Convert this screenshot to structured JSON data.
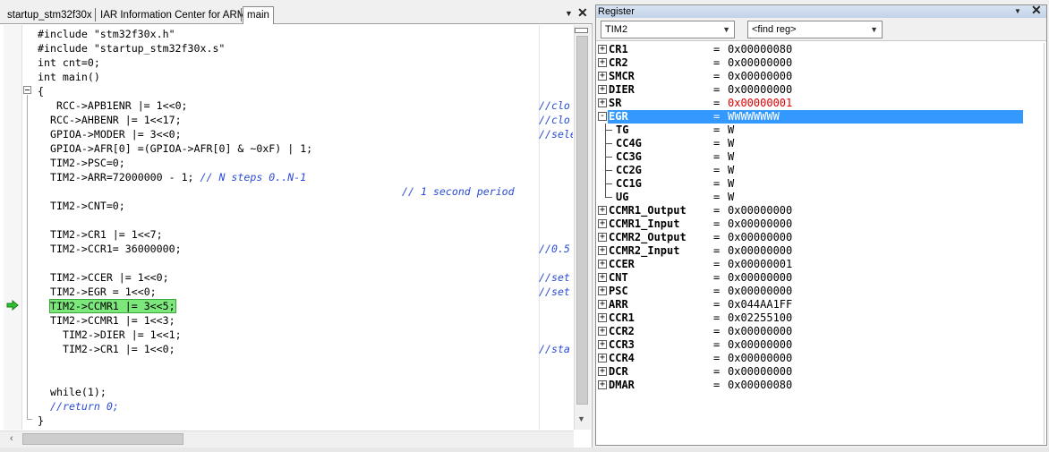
{
  "editor": {
    "tabs": [
      {
        "label": "startup_stm32f30x",
        "active": false
      },
      {
        "label": "IAR Information Center for ARM",
        "active": false
      },
      {
        "label": "main",
        "active": true
      }
    ],
    "dropdown_icon": "chevron-down-icon",
    "close_icon": "close-icon",
    "current_line_marker": "execution-arrow-icon",
    "code": {
      "l01": "#include \"stm32f30x.h\"",
      "l02": "#include \"startup_stm32f30x.s\"",
      "l03": "int cnt=0;",
      "l04": "int main()",
      "l05": "{",
      "l06": "  RCC->APB1ENR |= 1<<0;",
      "l06c": "//clo",
      "l07": "RCC->AHBENR |= 1<<17;",
      "l07c": "//clo",
      "l08": "GPIOA->MODER |= 3<<0;",
      "l08c": "//sele",
      "l09": "GPIOA->AFR[0] =(GPIOA->AFR[0] & ~0xF) | 1;",
      "l10": "TIM2->PSC=0;",
      "l11": "TIM2->ARR=72000000 - 1; ",
      "l11c": "// N steps 0..N-1",
      "l12c": "// 1 second period",
      "l13": "TIM2->CNT=0;",
      "l14": "TIM2->CR1 |= 1<<7;",
      "l15": "TIM2->CCR1= 36000000;",
      "l15c": "//0.5",
      "l16": "TIM2->CCER |= 1<<0;",
      "l16c": "//set",
      "l17": "TIM2->EGR = 1<<0;",
      "l17c": "//set",
      "l18": "TIM2->CCMR1 |= 3<<5;",
      "l19": "TIM2->CCMR1 |= 1<<3;",
      "l20": "  TIM2->DIER |= 1<<1;",
      "l21": "  TIM2->CR1 |= 1<<0;",
      "l21c": "//sta",
      "l22": "while(1);",
      "l23c": "//return 0;",
      "l24": "}"
    }
  },
  "register": {
    "title": "Register",
    "group_select": "TIM2",
    "find_reg_placeholder": "<find reg>",
    "equals": "=",
    "registers": [
      {
        "name": "CR1",
        "value": "0x00000080",
        "expander": "+"
      },
      {
        "name": "CR2",
        "value": "0x00000000",
        "expander": "+"
      },
      {
        "name": "SMCR",
        "value": "0x00000000",
        "expander": "+"
      },
      {
        "name": "DIER",
        "value": "0x00000000",
        "expander": "+"
      },
      {
        "name": "SR",
        "value": "0x00000001",
        "expander": "+",
        "changed": true
      },
      {
        "name": "EGR",
        "value": "WWWWWWWW",
        "expander": "-",
        "selected": true
      },
      {
        "name": "TG",
        "value": "W",
        "child": true
      },
      {
        "name": "CC4G",
        "value": "W",
        "child": true
      },
      {
        "name": "CC3G",
        "value": "W",
        "child": true
      },
      {
        "name": "CC2G",
        "value": "W",
        "child": true
      },
      {
        "name": "CC1G",
        "value": "W",
        "child": true
      },
      {
        "name": "UG",
        "value": "W",
        "child": true
      },
      {
        "name": "CCMR1_Output",
        "value": "0x00000000",
        "expander": "+"
      },
      {
        "name": "CCMR1_Input",
        "value": "0x00000000",
        "expander": "+"
      },
      {
        "name": "CCMR2_Output",
        "value": "0x00000000",
        "expander": "+"
      },
      {
        "name": "CCMR2_Input",
        "value": "0x00000000",
        "expander": "+"
      },
      {
        "name": "CCER",
        "value": "0x00000001",
        "expander": "+"
      },
      {
        "name": "CNT",
        "value": "0x00000000",
        "expander": "+"
      },
      {
        "name": "PSC",
        "value": "0x00000000",
        "expander": "+"
      },
      {
        "name": "ARR",
        "value": "0x044AA1FF",
        "expander": "+"
      },
      {
        "name": "CCR1",
        "value": "0x02255100",
        "expander": "+"
      },
      {
        "name": "CCR2",
        "value": "0x00000000",
        "expander": "+"
      },
      {
        "name": "CCR3",
        "value": "0x00000000",
        "expander": "+"
      },
      {
        "name": "CCR4",
        "value": "0x00000000",
        "expander": "+"
      },
      {
        "name": "DCR",
        "value": "0x00000000",
        "expander": "+"
      },
      {
        "name": "DMAR",
        "value": "0x00000080",
        "expander": "+"
      }
    ]
  },
  "colors": {
    "selection": "#3399ff",
    "changed_value": "#e00000",
    "current_statement": "#7ce87c",
    "comment": "#2a4bd7"
  }
}
